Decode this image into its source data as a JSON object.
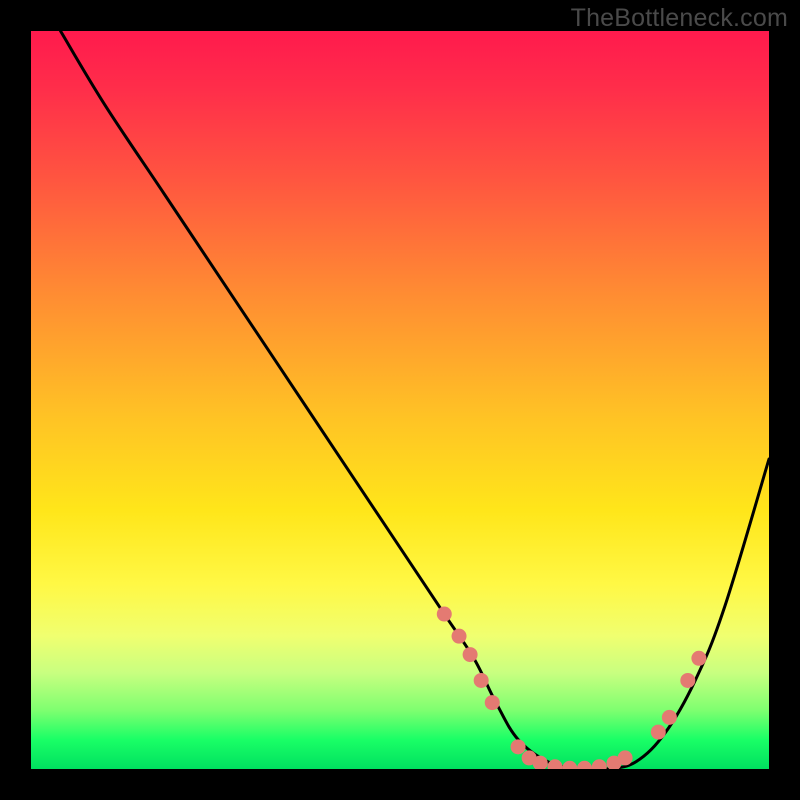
{
  "watermark": "TheBottleneck.com",
  "chart_data": {
    "type": "line",
    "title": "",
    "xlabel": "",
    "ylabel": "",
    "xlim": [
      0,
      100
    ],
    "ylim": [
      0,
      100
    ],
    "curve": {
      "name": "bottleneck-curve",
      "x": [
        4,
        10,
        18,
        26,
        34,
        42,
        50,
        56,
        60,
        63,
        66,
        70,
        74,
        78,
        82,
        86,
        90,
        94,
        100
      ],
      "y": [
        100,
        90,
        78,
        66,
        54,
        42,
        30,
        21,
        15,
        9,
        4,
        1,
        0,
        0,
        1,
        5,
        12,
        22,
        42
      ]
    },
    "markers": {
      "name": "highlight-dots",
      "color": "#e47a72",
      "points": [
        {
          "x": 56,
          "y": 21
        },
        {
          "x": 58,
          "y": 18
        },
        {
          "x": 59.5,
          "y": 15.5
        },
        {
          "x": 61,
          "y": 12
        },
        {
          "x": 62.5,
          "y": 9
        },
        {
          "x": 66,
          "y": 3
        },
        {
          "x": 67.5,
          "y": 1.5
        },
        {
          "x": 69,
          "y": 0.8
        },
        {
          "x": 71,
          "y": 0.3
        },
        {
          "x": 73,
          "y": 0.1
        },
        {
          "x": 75,
          "y": 0.1
        },
        {
          "x": 77,
          "y": 0.3
        },
        {
          "x": 79,
          "y": 0.8
        },
        {
          "x": 80.5,
          "y": 1.5
        },
        {
          "x": 85,
          "y": 5
        },
        {
          "x": 86.5,
          "y": 7
        },
        {
          "x": 89,
          "y": 12
        },
        {
          "x": 90.5,
          "y": 15
        }
      ]
    }
  }
}
